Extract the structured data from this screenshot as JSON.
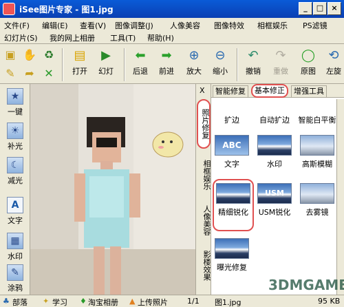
{
  "window": {
    "title": "iSee图片专家 - 图1.jpg",
    "buttons": {
      "minimize": "_",
      "maximize": "□",
      "close": "×"
    }
  },
  "menu": {
    "row1": [
      "文件(F)",
      "编辑(E)",
      "查看(V)",
      "图像调整(J)",
      "人像美容",
      "图像特效",
      "相框娱乐",
      "PS滤镜"
    ],
    "row2": [
      "幻灯片(S)",
      "我的网上相册",
      "工具(T)",
      "帮助(H)"
    ]
  },
  "toolbar": {
    "buttons": [
      "打开",
      "幻灯",
      "后退",
      "前进",
      "放大",
      "缩小",
      "撤销",
      "重做",
      "原图",
      "左旋"
    ]
  },
  "sidebar": {
    "items": [
      "一键",
      "补光",
      "减光",
      "文字",
      "水印",
      "涂鸦"
    ]
  },
  "vertical_tabs": [
    "照片修复",
    "相框娱乐",
    "人像美容",
    "影楼效果"
  ],
  "panel": {
    "close": "X",
    "tabs": [
      "智能修复",
      "基本修正",
      "增强工具"
    ],
    "tools": [
      "扩边",
      "自动扩边",
      "智能白平衡",
      "文字",
      "水印",
      "高斯模糊",
      "精细锐化",
      "USM锐化",
      "去雾镜",
      "曝光修复"
    ],
    "thumb_texts": {
      "text_thumb": "ABC",
      "usm_thumb": "USM"
    }
  },
  "statusbar": {
    "items": [
      "部落",
      "学习",
      "淘宝相册",
      "上传照片",
      "1/1",
      "图1.jpg",
      "95 KB"
    ]
  },
  "watermark": "3DMGAME",
  "colors": {
    "title_bar": "#0a5bd7",
    "highlight_circle": "#e05050"
  }
}
